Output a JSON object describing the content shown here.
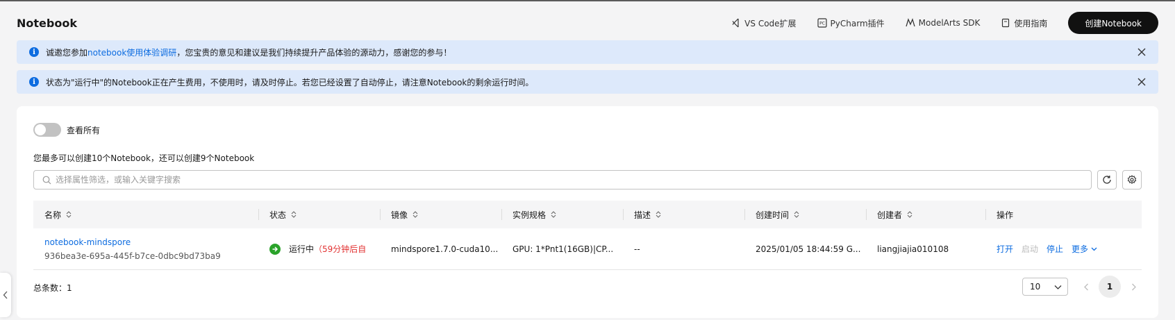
{
  "header": {
    "title": "Notebook",
    "links": [
      {
        "label": "VS Code扩展",
        "icon": "vscode-icon"
      },
      {
        "label": "PyCharm插件",
        "icon": "pycharm-icon"
      },
      {
        "label": "ModelArts SDK",
        "icon": "modelarts-icon"
      },
      {
        "label": "使用指南",
        "icon": "guide-icon"
      }
    ],
    "create_label": "创建Notebook"
  },
  "alerts": {
    "survey": {
      "prefix": "诚邀您参加",
      "link": "notebook使用体验调研",
      "suffix": "，您宝贵的意见和建议是我们持续提升产品体验的源动力，感谢您的参与！"
    },
    "billing": {
      "text": "状态为\"运行中\"的Notebook正在产生费用，不使用时，请及时停止。若您已经设置了自动停止，请注意Notebook的剩余运行时间。"
    }
  },
  "panel": {
    "view_all_label": "查看所有",
    "quota_text": "您最多可以创建10个Notebook，还可以创建9个Notebook",
    "search_placeholder": "选择属性筛选，或输入关键字搜索"
  },
  "table": {
    "columns": [
      "名称",
      "状态",
      "镜像",
      "实例规格",
      "描述",
      "创建时间",
      "创建者",
      "操作"
    ],
    "rows": [
      {
        "name": "notebook-mindspore",
        "id": "936bea3e-695a-445f-b7ce-0dbc9bd73ba9",
        "status": "运行中",
        "status_remaining": "（59分钟后自",
        "image": "mindspore1.7.0-cuda10...",
        "flavor": "GPU: 1*Pnt1(16GB)|CP...",
        "description": "--",
        "created_at": "2025/01/05 18:44:59 G...",
        "creator": "liangjiajia010108",
        "actions": {
          "open": "打开",
          "start": "启动",
          "stop": "停止",
          "more": "更多"
        }
      }
    ]
  },
  "footer": {
    "total_text": "总条数：1",
    "page_size": "10",
    "current_page": "1"
  },
  "colors": {
    "accent": "#0d6ce0",
    "running": "#2aa32a",
    "warning": "#e23232",
    "primary_button": "#111111"
  }
}
